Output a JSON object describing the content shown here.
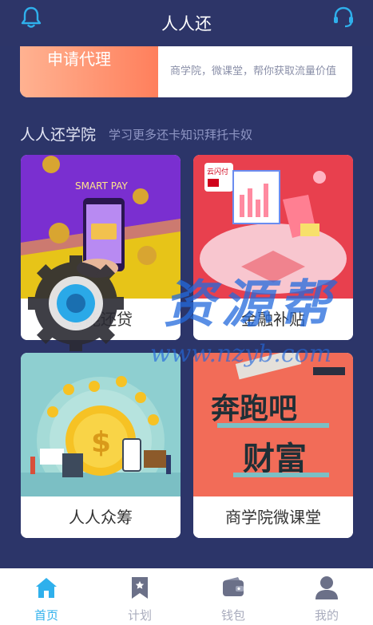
{
  "header": {
    "title": "人人还",
    "left_icon": "bell-icon",
    "right_icon": "headset-icon",
    "color_accent": "#2fb0ec"
  },
  "banner": {
    "left_text": "申请代理",
    "right_text": "商学院，微课堂，帮你获取流量价值"
  },
  "section": {
    "title": "人人还学院",
    "subtitle": "学习更多还卡知识拜托卡奴"
  },
  "cards": [
    {
      "label": "智能还贷",
      "image_text": "SMART PAY"
    },
    {
      "label": "金融补贴",
      "image_text": "云闪付"
    },
    {
      "label": "人人众筹"
    },
    {
      "label": "商学院微课堂",
      "image_text": "奔跑吧财富"
    }
  ],
  "watermark": {
    "text": "资源帮",
    "url": "www.nzyb.com"
  },
  "tabs": [
    {
      "label": "首页",
      "icon": "home-icon",
      "active": true
    },
    {
      "label": "计划",
      "icon": "bookmark-icon"
    },
    {
      "label": "钱包",
      "icon": "wallet-icon"
    },
    {
      "label": "我的",
      "icon": "user-icon"
    }
  ]
}
